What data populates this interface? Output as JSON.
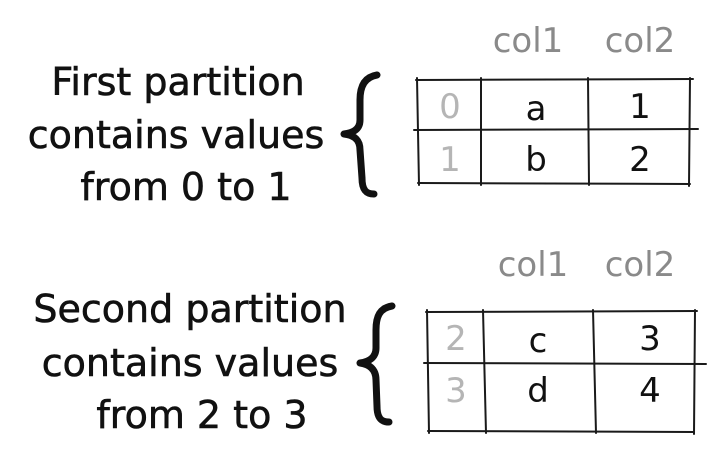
{
  "partitions": [
    {
      "caption_lines": [
        "First partition",
        "contains values",
        "from 0 to 1"
      ],
      "columns": [
        "col1",
        "col2"
      ],
      "rows": [
        {
          "index": "0",
          "col1": "a",
          "col2": "1"
        },
        {
          "index": "1",
          "col1": "b",
          "col2": "2"
        }
      ]
    },
    {
      "caption_lines": [
        "Second partition",
        "contains values",
        "from 2 to 3"
      ],
      "columns": [
        "col1",
        "col2"
      ],
      "rows": [
        {
          "index": "2",
          "col1": "c",
          "col2": "3"
        },
        {
          "index": "3",
          "col1": "d",
          "col2": "4"
        }
      ]
    }
  ],
  "colors": {
    "ink": "#111111",
    "header_gray": "#8a8a8a",
    "index_gray": "#b5b5b5"
  }
}
